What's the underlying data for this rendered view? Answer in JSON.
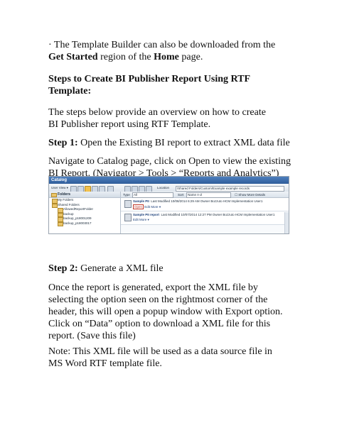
{
  "intro": {
    "bullet": "·",
    "pre": " The Template Builder can also be downloaded from the ",
    "b1": "Get Started",
    "mid": " region of the ",
    "b2": "Home",
    "post": " page."
  },
  "heading": "Steps to Create BI Publisher Report Using RTF Template:",
  "overview": "The steps below provide an overview on how to create BI Publisher report using RTF Template.",
  "step1": {
    "label": "Step 1:",
    "text": " Open the Existing BI report to extract XML data file"
  },
  "navigate": "Navigate to Catalog page, click on Open to view the existing BI Report. (Navigator > Tools > “Reports and Analytics”)",
  "screenshot": {
    "title": "Catalog",
    "user_view": "User View ▾",
    "location_label": "Location",
    "location_value": "/Shared Folders/Custom/Example example records",
    "type_label": "Type",
    "type_value": "All",
    "sort_label": "Sort",
    "sort_value": "Name A-Z",
    "show_more": "Show More Details",
    "folders_label": "Folders",
    "tree": [
      "My Folders",
      "Shared Folders",
      "AllowedReportFolder",
      "backup",
      "backup_p18001209",
      "backup_p18003017"
    ],
    "reports": [
      {
        "name": "Sample PII",
        "meta": "Last Modified 10/08/2014 6:29 AM   Owner Bozzuto HCM Implementation User1",
        "open": "Open",
        "edit": "Edit",
        "more": "More ▾"
      },
      {
        "name": "Sample PII report",
        "meta": "Last Modified 10/07/2014 12:27 PM   Owner Bozzuto HCM Implementation User1",
        "open": "",
        "edit": "Edit",
        "more": "More ▾"
      }
    ]
  },
  "step2": {
    "label": "Step 2:",
    "text": " Generate a XML file"
  },
  "export_para": "Once the report is generated, export the XML file by selecting the option seen on the rightmost corner of the header, this will open a popup window with Export option. Click on “Data” option to download a XML file for this report. (Save this file)",
  "note": "Note: This XML file will be used as a data source file in MS Word RTF template file."
}
